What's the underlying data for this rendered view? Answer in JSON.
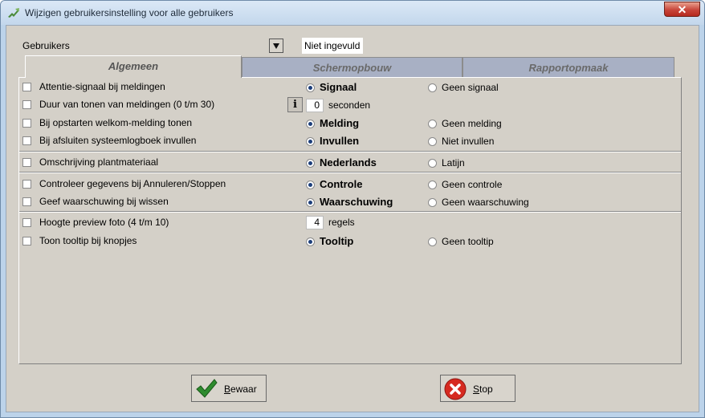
{
  "window": {
    "title": "Wijzigen gebruikersinstelling voor alle gebruikers",
    "close_label": "✕"
  },
  "users": {
    "label": "Gebruikers",
    "value": "Niet ingevuld"
  },
  "tabs": [
    {
      "label": "Algemeen",
      "active": true
    },
    {
      "label": "Schermopbouw",
      "active": false
    },
    {
      "label": "Rapportopmaak",
      "active": false
    }
  ],
  "rows": [
    {
      "text": "Attentie-signaal bij meldingen",
      "opt1": "Signaal",
      "opt2": "Geen signaal"
    },
    {
      "text": "Duur van tonen van meldingen (0 t/m 30)",
      "info": "i",
      "value": "0",
      "unit": "seconden"
    },
    {
      "text": "Bij opstarten welkom-melding tonen",
      "opt1": "Melding",
      "opt2": "Geen melding"
    },
    {
      "text": "Bij afsluiten systeemlogboek invullen",
      "opt1": "Invullen",
      "opt2": "Niet invullen"
    },
    {
      "text": "Omschrijving plantmateriaal",
      "opt1": "Nederlands",
      "opt2": "Latijn"
    },
    {
      "text": "Controleer gegevens bij Annuleren/Stoppen",
      "opt1": "Controle",
      "opt2": "Geen controle"
    },
    {
      "text": "Geef waarschuwing bij wissen",
      "opt1": "Waarschuwing",
      "opt2": "Geen waarschuwing"
    },
    {
      "text": "Hoogte preview foto (4 t/m 10)",
      "value": "4",
      "unit": "regels"
    },
    {
      "text": "Toon tooltip bij knopjes",
      "opt1": "Tooltip",
      "opt2": "Geen tooltip"
    }
  ],
  "buttons": {
    "save_key": "B",
    "save_rest": "ewaar",
    "stop_key": "S",
    "stop_rest": "top"
  }
}
